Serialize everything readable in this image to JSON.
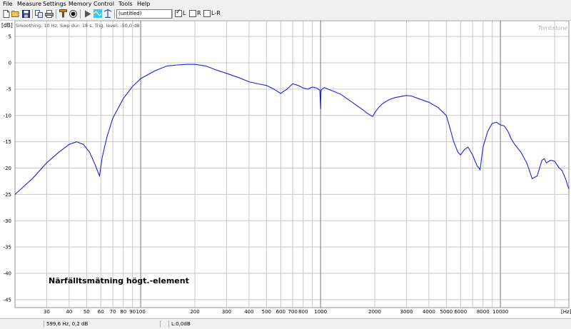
{
  "menu": [
    "File",
    "Measure",
    "Settings",
    "Memory",
    "Control",
    "Tools",
    "Help"
  ],
  "toolbar": {
    "icons": [
      "new-icon",
      "open-icon",
      "save-icon",
      "copy-icon",
      "print-icon",
      "calibrate-icon",
      "record-icon",
      "play-icon",
      "generator-icon",
      "trigger-icon"
    ],
    "measurement_name": "(untitled)",
    "channels": [
      {
        "label": "L",
        "checked": true
      },
      {
        "label": "R",
        "checked": false
      },
      {
        "label": "L-R",
        "checked": false
      }
    ]
  },
  "plot": {
    "unit_label": "[dB]",
    "info_text": "Smoothing: 10 Hz, Swp dur: 18 s, Trig. level: -50,0 dB",
    "watermark": "Tombstone",
    "annotation": "Närfälltsmätning högt.-element",
    "hz_label": "[Hz]",
    "curve_color": "#2020e0"
  },
  "chart_data": {
    "type": "line",
    "xscale": "log",
    "xlim": [
      20,
      24000
    ],
    "ylim": [
      -46.5,
      8
    ],
    "yticks": [
      5,
      0,
      -5,
      -10,
      -15,
      -20,
      -25,
      -30,
      -35,
      -40,
      -45
    ],
    "xtick_labels": [
      {
        "v": 30,
        "t": "30"
      },
      {
        "v": 40,
        "t": "40"
      },
      {
        "v": 50,
        "t": "50"
      },
      {
        "v": 60,
        "t": "60"
      },
      {
        "v": 70,
        "t": "70"
      },
      {
        "v": 80,
        "t": "80"
      },
      {
        "v": 90,
        "t": "90"
      },
      {
        "v": 100,
        "t": "100"
      },
      {
        "v": 200,
        "t": "200"
      },
      {
        "v": 300,
        "t": "300"
      },
      {
        "v": 400,
        "t": "400"
      },
      {
        "v": 500,
        "t": "500"
      },
      {
        "v": 600,
        "t": "600"
      },
      {
        "v": 700,
        "t": "700"
      },
      {
        "v": 800,
        "t": "800"
      },
      {
        "v": 1000,
        "t": "1000"
      },
      {
        "v": 2000,
        "t": "2000"
      },
      {
        "v": 3000,
        "t": "3000"
      },
      {
        "v": 4000,
        "t": "4000"
      },
      {
        "v": 5000,
        "t": "5000"
      },
      {
        "v": 6000,
        "t": "6000"
      },
      {
        "v": 8000,
        "t": "8000"
      },
      {
        "v": 10000,
        "t": "10000"
      }
    ],
    "grid": true,
    "series": [
      {
        "x": [
          20,
          25,
          30,
          35,
          40,
          44,
          48,
          52,
          56,
          59,
          61,
          65,
          70,
          80,
          90,
          100,
          120,
          140,
          160,
          180,
          200,
          230,
          260,
          300,
          350,
          400,
          450,
          500,
          550,
          580,
          600,
          650,
          700,
          750,
          800,
          850,
          900,
          950,
          990,
          1000,
          1005,
          1010,
          1050,
          1100,
          1200,
          1300,
          1400,
          1500,
          1600,
          1700,
          1800,
          1900,
          1950,
          2000,
          2100,
          2200,
          2400,
          2600,
          2800,
          3000,
          3200,
          3500,
          4000,
          4500,
          5000,
          5200,
          5500,
          5800,
          6000,
          6300,
          6600,
          7000,
          7400,
          7700,
          8000,
          8500,
          9000,
          9500,
          10000,
          10500,
          11000,
          11500,
          12000,
          13000,
          14000,
          15000,
          16000,
          17000,
          17500,
          18000,
          19000,
          20000,
          21000,
          22000,
          23000,
          24000
        ],
        "y": [
          -25,
          -22,
          -19,
          -17,
          -15.5,
          -15,
          -15.5,
          -17,
          -19.5,
          -21.5,
          -18,
          -14,
          -10.5,
          -6.8,
          -4.5,
          -3,
          -1.5,
          -0.6,
          -0.4,
          -0.3,
          -0.3,
          -0.6,
          -1.3,
          -2,
          -2.8,
          -3.6,
          -4,
          -4.3,
          -5,
          -5.5,
          -5.8,
          -5,
          -4,
          -4.3,
          -4.8,
          -5,
          -4.6,
          -4.8,
          -5.2,
          -8.8,
          -5.5,
          -5.1,
          -4.7,
          -5,
          -5.5,
          -6,
          -6.8,
          -7.5,
          -8.2,
          -8.8,
          -9.5,
          -10,
          -10.2,
          -9.5,
          -8.5,
          -7.8,
          -7,
          -6.6,
          -6.4,
          -6.2,
          -6.3,
          -6.8,
          -7.5,
          -8.5,
          -10,
          -12,
          -15,
          -17,
          -17.5,
          -16.5,
          -16,
          -17.5,
          -19.5,
          -20.3,
          -16,
          -13,
          -11.5,
          -11.3,
          -11.8,
          -12,
          -13,
          -14.5,
          -15.5,
          -17,
          -19,
          -22,
          -21.5,
          -18.5,
          -18.2,
          -19,
          -18.5,
          -18.7,
          -19.8,
          -20.5,
          -22,
          -24
        ]
      }
    ]
  },
  "status": {
    "cursor": "599,6 Hz, 0,2 dB",
    "level": "L:0,0dB"
  }
}
